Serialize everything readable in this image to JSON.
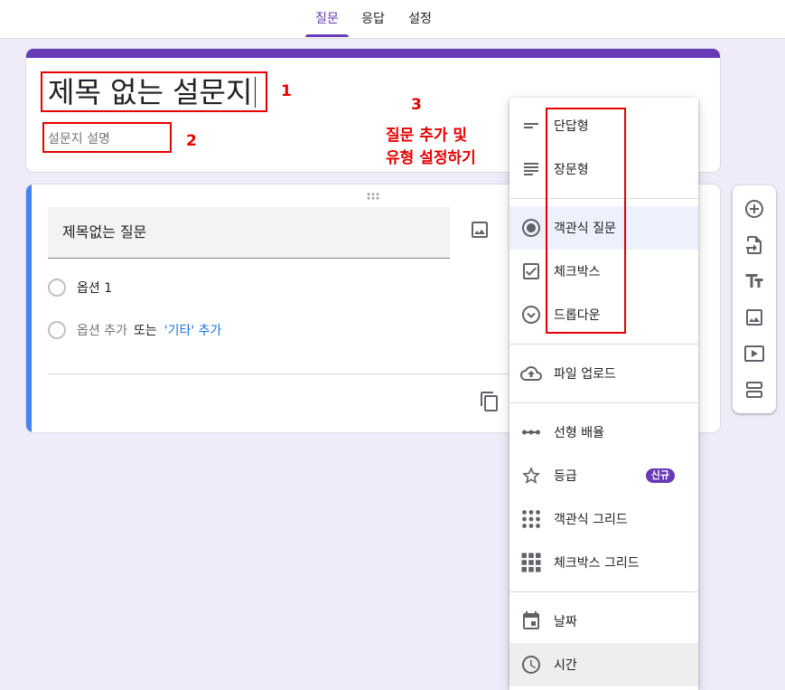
{
  "colors": {
    "accent": "#673ab7",
    "page_background": "#f0ebf8",
    "active_question_bar": "#4285f4",
    "link": "#1a73e8",
    "annotation_red": "#e60000",
    "selected_item_background": "#ecf1fb",
    "hovered_item_background": "#eeeeee",
    "icon": "#5f6368"
  },
  "tabs": [
    {
      "label": "질문",
      "active": true
    },
    {
      "label": "응답",
      "active": false
    },
    {
      "label": "설정",
      "active": false
    }
  ],
  "form": {
    "title": "제목 없는 설문지",
    "description_placeholder": "설문지 설명"
  },
  "annotations": {
    "title_marker": "1",
    "description_marker": "2",
    "menu_marker": "3",
    "menu_note": [
      "질문 추가 및",
      "유형 설정하기"
    ]
  },
  "question": {
    "title_placeholder": "제목없는 질문",
    "options": [
      {
        "label": "옵션 1"
      }
    ],
    "add_option": "옵션 추가",
    "or_text": "또는",
    "add_other": "'기타' 추가",
    "icons": {
      "drag": "drag-indicator-icon",
      "image": "image-icon",
      "copy": "copy-icon"
    }
  },
  "question_type_menu": {
    "items": [
      {
        "label": "단답형",
        "icon": "short-text-icon"
      },
      {
        "label": "장문형",
        "icon": "paragraph-icon"
      },
      {
        "label": "객관식 질문",
        "icon": "radio-button-icon",
        "selected": true
      },
      {
        "label": "체크박스",
        "icon": "checkbox-icon"
      },
      {
        "label": "드롭다운",
        "icon": "dropdown-icon"
      },
      {
        "label": "파일 업로드",
        "icon": "cloud-upload-icon"
      },
      {
        "label": "선형 배율",
        "icon": "linear-scale-icon"
      },
      {
        "label": "등급",
        "icon": "star-icon",
        "badge": "신규"
      },
      {
        "label": "객관식 그리드",
        "icon": "dot-grid-icon"
      },
      {
        "label": "체크박스 그리드",
        "icon": "checkbox-grid-icon"
      },
      {
        "label": "날짜",
        "icon": "calendar-icon"
      },
      {
        "label": "시간",
        "icon": "clock-icon",
        "hovered": true
      }
    ]
  },
  "side_toolbar": {
    "icons": [
      "add-circle-icon",
      "import-questions-icon",
      "title-text-icon",
      "image-icon",
      "video-icon",
      "section-icon"
    ]
  }
}
